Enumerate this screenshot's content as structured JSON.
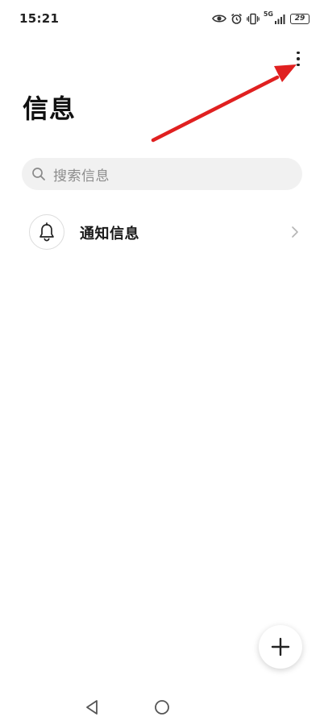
{
  "status_bar": {
    "time": "15:21",
    "network_label": "5G",
    "battery_level": "29",
    "icons": [
      "eye-icon",
      "alarm-icon",
      "vibrate-icon",
      "signal-icon",
      "battery-icon"
    ]
  },
  "header": {
    "title": "信息",
    "menu_icon": "more-vertical-icon"
  },
  "search": {
    "placeholder": "搜索信息",
    "icon": "search-icon"
  },
  "list": {
    "items": [
      {
        "label": "通知信息",
        "icon": "bell-icon",
        "chevron": "chevron-right-icon"
      }
    ]
  },
  "fab": {
    "icon": "plus-icon"
  },
  "nav_bar": {
    "icons": [
      "back-triangle-icon",
      "home-circle-icon"
    ]
  },
  "annotation": {
    "color": "#e02020",
    "points_to": "more-options-button"
  },
  "colors": {
    "background": "#ffffff",
    "search_background": "#f1f1f1",
    "placeholder_text": "#8c8c8c",
    "primary_text": "#111111"
  }
}
